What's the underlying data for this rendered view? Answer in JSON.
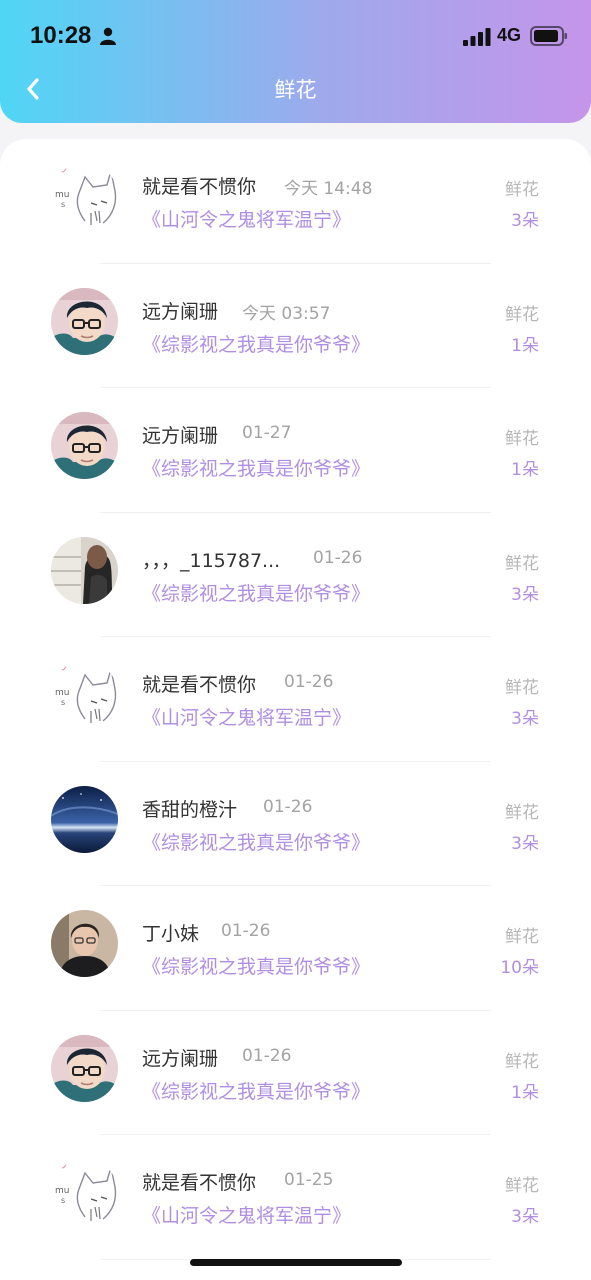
{
  "status_bar": {
    "time": "10:28",
    "network": "4G"
  },
  "nav": {
    "title": "鲜花"
  },
  "colors": {
    "accent": "#b08fe2",
    "header_start": "#4fd6f5",
    "header_end": "#c595ea"
  },
  "items": [
    {
      "avatar": "cat-sketch-avatar",
      "name": "就是看不惯你",
      "time": "今天 14:48",
      "book": "《山河令之鬼将军温宁》",
      "gift": "鲜花",
      "count": "3朵"
    },
    {
      "avatar": "glasses-boy-avatar",
      "name": "远方阑珊",
      "time": "今天 03:57",
      "book": "《综影视之我真是你爷爷》",
      "gift": "鲜花",
      "count": "1朵"
    },
    {
      "avatar": "glasses-boy-avatar",
      "name": "远方阑珊",
      "time": "01-27",
      "book": "《综影视之我真是你爷爷》",
      "gift": "鲜花",
      "count": "1朵"
    },
    {
      "avatar": "girl-photo-avatar",
      "name": "，，，_115787...",
      "time": "01-26",
      "book": "《综影视之我真是你爷爷》",
      "gift": "鲜花",
      "count": "3朵"
    },
    {
      "avatar": "cat-sketch-avatar",
      "name": "就是看不惯你",
      "time": "01-26",
      "book": "《山河令之鬼将军温宁》",
      "gift": "鲜花",
      "count": "3朵"
    },
    {
      "avatar": "night-sky-avatar",
      "name": "香甜的橙汁",
      "time": "01-26",
      "book": "《综影视之我真是你爷爷》",
      "gift": "鲜花",
      "count": "3朵"
    },
    {
      "avatar": "man-photo-avatar",
      "name": "丁小妹",
      "time": "01-26",
      "book": "《综影视之我真是你爷爷》",
      "gift": "鲜花",
      "count": "10朵"
    },
    {
      "avatar": "glasses-boy-avatar",
      "name": "远方阑珊",
      "time": "01-26",
      "book": "《综影视之我真是你爷爷》",
      "gift": "鲜花",
      "count": "1朵"
    },
    {
      "avatar": "cat-sketch-avatar",
      "name": "就是看不惯你",
      "time": "01-25",
      "book": "《山河令之鬼将军温宁》",
      "gift": "鲜花",
      "count": "3朵"
    }
  ]
}
